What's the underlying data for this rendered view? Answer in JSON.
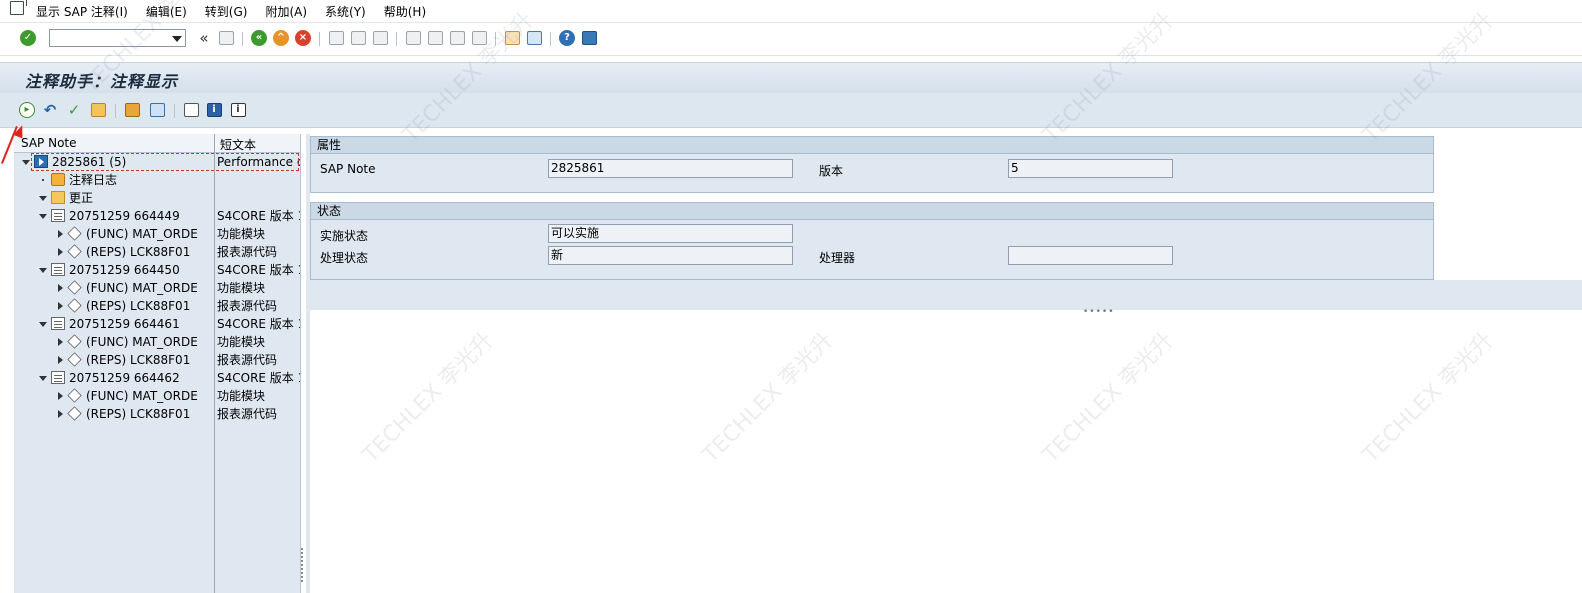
{
  "menu": {
    "items": [
      "显示 SAP 注释(I)",
      "编辑(E)",
      "转到(G)",
      "附加(A)",
      "系统(Y)",
      "帮助(H)"
    ]
  },
  "toolbar": {
    "command_field_value": "",
    "back_chevrons": "«"
  },
  "title": "注释助手：注释显示",
  "tree": {
    "headers": {
      "col1": "SAP Note",
      "col2": "短文本"
    },
    "rows": [
      {
        "name": "2825861 (5)",
        "short": "Performance of",
        "level": 0,
        "icon": "note-icon",
        "expander": "down"
      },
      {
        "name": "注释日志",
        "short": "",
        "level": 1,
        "icon": "log-icon",
        "expander": "dot"
      },
      {
        "name": "更正",
        "short": "",
        "level": 1,
        "icon": "folder-icon",
        "expander": "down"
      },
      {
        "name": "20751259 664449",
        "short": "S4CORE 版本 1",
        "level": 2,
        "icon": "document-icon",
        "expander": "down"
      },
      {
        "name": "(FUNC)  MAT_ORDE",
        "short": "功能模块",
        "level": 3,
        "icon": "object-icon",
        "expander": "right"
      },
      {
        "name": "(REPS)  LCK88F01",
        "short": "报表源代码",
        "level": 3,
        "icon": "object-icon",
        "expander": "right"
      },
      {
        "name": "20751259 664450",
        "short": "S4CORE 版本 1",
        "level": 2,
        "icon": "document-icon",
        "expander": "down"
      },
      {
        "name": "(FUNC)  MAT_ORDE",
        "short": "功能模块",
        "level": 3,
        "icon": "object-icon",
        "expander": "right"
      },
      {
        "name": "(REPS)  LCK88F01",
        "short": "报表源代码",
        "level": 3,
        "icon": "object-icon",
        "expander": "right"
      },
      {
        "name": "20751259 664461",
        "short": "S4CORE 版本 1",
        "level": 2,
        "icon": "document-icon",
        "expander": "down"
      },
      {
        "name": "(FUNC)  MAT_ORDE",
        "short": "功能模块",
        "level": 3,
        "icon": "object-icon",
        "expander": "right"
      },
      {
        "name": "(REPS)  LCK88F01",
        "short": "报表源代码",
        "level": 3,
        "icon": "object-icon",
        "expander": "right"
      },
      {
        "name": "20751259 664462",
        "short": "S4CORE 版本 1",
        "level": 2,
        "icon": "document-icon",
        "expander": "down"
      },
      {
        "name": "(FUNC)  MAT_ORDE",
        "short": "功能模块",
        "level": 3,
        "icon": "object-icon",
        "expander": "right"
      },
      {
        "name": "(REPS)  LCK88F01",
        "short": "报表源代码",
        "level": 3,
        "icon": "object-icon",
        "expander": "right"
      }
    ]
  },
  "attributes": {
    "heading": "属性",
    "sap_note_label": "SAP Note",
    "sap_note_value": "2825861",
    "version_label": "版本",
    "version_value": "5"
  },
  "status": {
    "heading": "状态",
    "impl_label": "实施状态",
    "impl_value": "可以实施",
    "proc_label": "处理状态",
    "proc_value": "新",
    "processor_label": "处理器",
    "processor_value": ""
  },
  "watermark": "TECHLEX 李光升"
}
